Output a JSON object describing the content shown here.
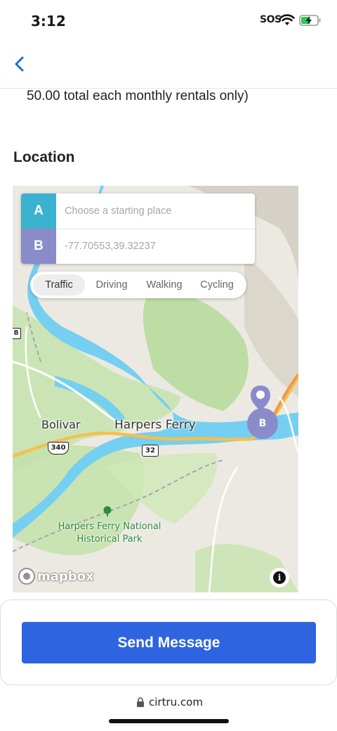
{
  "status_bar": {
    "time": "3:12",
    "sos": "SOS",
    "icons": [
      "wifi-icon",
      "battery-charging-icon"
    ]
  },
  "nav": {
    "back_icon": "chevron-left-icon"
  },
  "listing": {
    "rental_text": "50.00 total each monthly rentals only)"
  },
  "location": {
    "title": "Location",
    "route": {
      "a_label": "A",
      "a_placeholder": "Choose a starting place",
      "b_label": "B",
      "b_placeholder": "-77.70553,39.32237"
    },
    "modes": [
      "Traffic",
      "Driving",
      "Walking",
      "Cycling"
    ],
    "active_mode": "Traffic",
    "map_labels": {
      "town1": "Bolivar",
      "town2": "Harpers Ferry",
      "park_line1": "Harpers Ferry National",
      "park_line2": "Historical Park",
      "route_340": "340",
      "route_32": "32",
      "edge_shield": "8"
    },
    "marker_b": "B",
    "attribution": "mapbox",
    "info": "i"
  },
  "actions": {
    "send_label": "Send Message"
  },
  "browser": {
    "url": "cirtru.com"
  },
  "colors": {
    "accent": "#2f64e0",
    "marker_a": "#3bb2d0",
    "marker_b": "#8a8bc9",
    "water": "#75cff0"
  }
}
